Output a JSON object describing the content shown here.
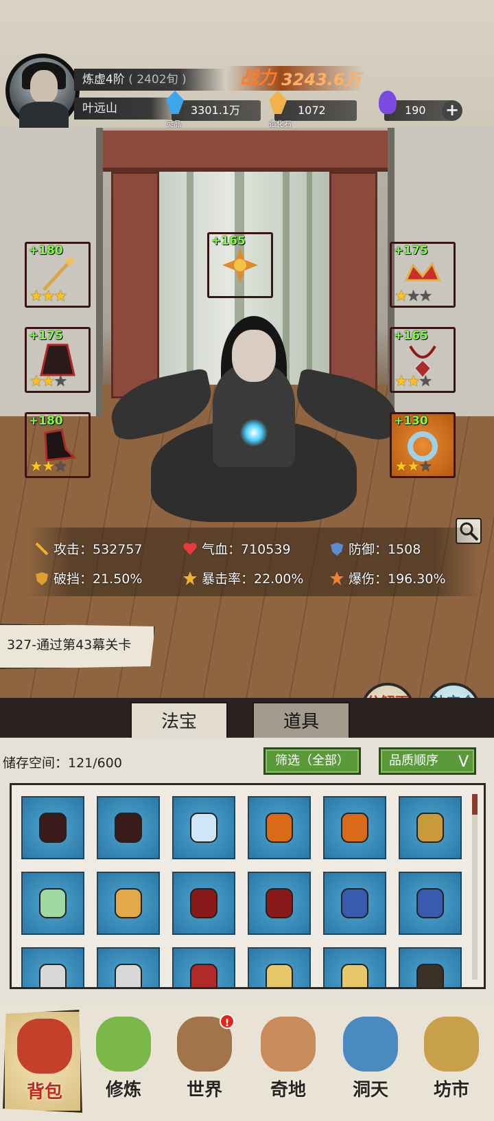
{
  "player": {
    "realm": "炼虚4阶",
    "realm_detail": "( 2402旬 )",
    "name": "叶远山",
    "power_label": "战力",
    "power_value": "3243.6万"
  },
  "resources": [
    {
      "icon": "spirit-crystal-icon",
      "caption": "灵晶",
      "value": "3301.1万",
      "color": "#3aa7e8"
    },
    {
      "icon": "dao-stone-icon",
      "caption": "造化石",
      "value": "1072",
      "color": "#f2b24a"
    },
    {
      "icon": "soul-flame-icon",
      "caption": "",
      "value": "190",
      "color": "#7a4ae0"
    }
  ],
  "add_button": "+",
  "equipment": [
    {
      "slot": "weapon",
      "plus": "+180",
      "stars": 3,
      "max_stars": 3,
      "rarity": "red"
    },
    {
      "slot": "talisman",
      "plus": "+165",
      "stars": 0,
      "max_stars": 0,
      "rarity": "red"
    },
    {
      "slot": "headband",
      "plus": "+175",
      "stars": 1,
      "max_stars": 3,
      "rarity": "red"
    },
    {
      "slot": "robe",
      "plus": "+175",
      "stars": 2,
      "max_stars": 3,
      "rarity": "red"
    },
    {
      "slot": "necklace",
      "plus": "+165",
      "stars": 2,
      "max_stars": 3,
      "rarity": "red"
    },
    {
      "slot": "boots",
      "plus": "+180",
      "stars": 2,
      "max_stars": 3,
      "rarity": "red"
    },
    {
      "slot": "ring",
      "plus": "+130",
      "stars": 2,
      "max_stars": 3,
      "rarity": "orange"
    }
  ],
  "stats": {
    "attack": "攻击：532757",
    "hp": "气血：710539",
    "defense": "防御：1508",
    "pierce": "破挡：21.50%",
    "crit_rate": "暴击率：22.00%",
    "crit_damage": "爆伤：196.30%"
  },
  "quest": "327-通过第43幕关卡",
  "buttons": {
    "decompose": "分解再造",
    "synthesize": "法宝合成"
  },
  "tabs": {
    "fabao": "法宝",
    "daoju": "道具"
  },
  "inventory": {
    "storage": "储存空间：121/600",
    "filter": "筛选（全部）",
    "sort": "品质顺序",
    "sort_chevron": "V",
    "items": [
      {
        "icon": "dark-ring-icon",
        "color": "#3a1a1a"
      },
      {
        "icon": "dark-ring-icon",
        "color": "#3a1a1a"
      },
      {
        "icon": "jade-sword-icon",
        "color": "#cfe6f6"
      },
      {
        "icon": "flame-axe-icon",
        "color": "#d86a1a"
      },
      {
        "icon": "flame-axe-icon",
        "color": "#d86a1a"
      },
      {
        "icon": "golden-staff-icon",
        "color": "#c89a3a"
      },
      {
        "icon": "jade-mirror-icon",
        "color": "#9fd8a0"
      },
      {
        "icon": "golden-armor-icon",
        "color": "#e3a84a"
      },
      {
        "icon": "crimson-robe-icon",
        "color": "#8a1a1a"
      },
      {
        "icon": "crimson-robe-icon",
        "color": "#8a1a1a"
      },
      {
        "icon": "blue-robe-icon",
        "color": "#3a5ab0"
      },
      {
        "icon": "blue-robe-icon",
        "color": "#3a5ab0"
      },
      {
        "icon": "silver-armor-icon",
        "color": "#d8d8d8"
      },
      {
        "icon": "silver-armor-icon",
        "color": "#d8d8d8"
      },
      {
        "icon": "red-helm-icon",
        "color": "#b02a2a"
      },
      {
        "icon": "gold-armor-icon",
        "color": "#e7c76a"
      },
      {
        "icon": "gold-armor-icon",
        "color": "#e7c76a"
      },
      {
        "icon": "dark-cannon-icon",
        "color": "#3a3226"
      }
    ]
  },
  "nav": [
    {
      "id": "bag",
      "label": "背包",
      "icon": "bag-icon",
      "color": "#c5402a"
    },
    {
      "id": "cultivate",
      "label": "修炼",
      "icon": "lotus-icon",
      "color": "#7ab84a"
    },
    {
      "id": "world",
      "label": "世界",
      "icon": "scroll-icon",
      "color": "#a3744a",
      "badge": "!"
    },
    {
      "id": "wonder",
      "label": "奇地",
      "icon": "floating-isle-icon",
      "color": "#c98b5a"
    },
    {
      "id": "cave",
      "label": "洞天",
      "icon": "portal-icon",
      "color": "#4a8ac0"
    },
    {
      "id": "market",
      "label": "坊市",
      "icon": "market-stall-icon",
      "color": "#c9a04a"
    }
  ]
}
